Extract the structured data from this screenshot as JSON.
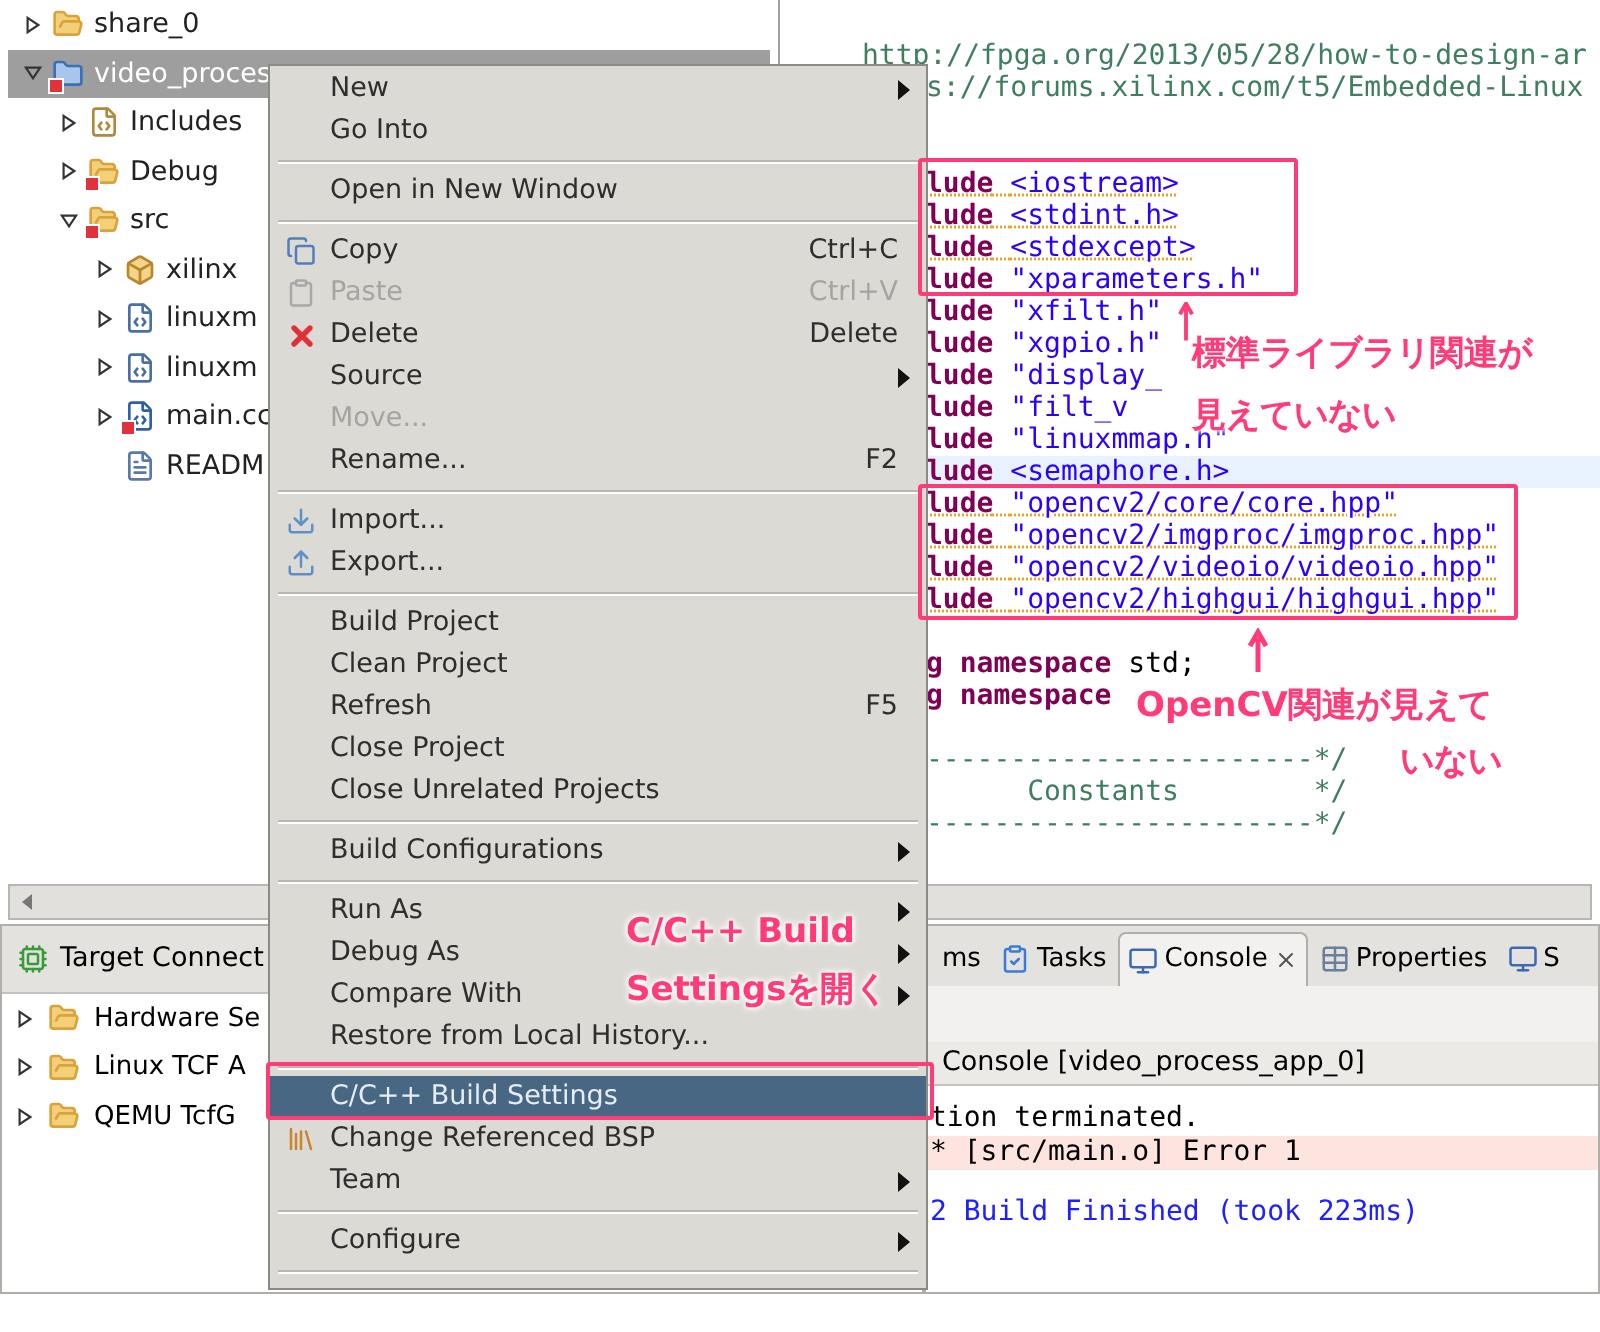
{
  "project_explorer": {
    "items": [
      {
        "label": "share_0",
        "kind": "folder",
        "expanded": false,
        "selected": false,
        "error": false
      },
      {
        "label": "video_proces",
        "kind": "project",
        "expanded": true,
        "selected": true,
        "error": true,
        "children": [
          {
            "label": "Includes",
            "kind": "includes",
            "expanded": false,
            "selected": false,
            "error": false
          },
          {
            "label": "Debug",
            "kind": "folder",
            "expanded": false,
            "selected": false,
            "error": true
          },
          {
            "label": "src",
            "kind": "folder",
            "expanded": true,
            "selected": false,
            "error": true,
            "children": [
              {
                "label": "xilinx",
                "kind": "package",
                "expanded": false,
                "selected": false,
                "error": false
              },
              {
                "label": "linuxm",
                "kind": "source",
                "expanded": false,
                "selected": false,
                "error": false
              },
              {
                "label": "linuxm",
                "kind": "header",
                "expanded": false,
                "selected": false,
                "error": false
              },
              {
                "label": "main.cc",
                "kind": "cfile",
                "expanded": false,
                "selected": false,
                "error": true
              },
              {
                "label": "READM",
                "kind": "text",
                "selected": false,
                "error": false
              }
            ]
          }
        ]
      }
    ]
  },
  "editor": {
    "top_line": "http://fpga.org/2013/05/28/how-to-design-ar",
    "lines": [
      {
        "text": "s://forums.xilinx.com/t5/Embedded-Linux",
        "kind": "comment",
        "warning": false,
        "current": false
      },
      {
        "kind": "blank",
        "current": false
      },
      {
        "kind": "blank",
        "current": false
      },
      {
        "keyword": "lude",
        "text": "<iostream>",
        "kind": "string",
        "warning": true,
        "current": false
      },
      {
        "keyword": "lude",
        "text": "<stdint.h>",
        "kind": "string",
        "warning": true,
        "current": false
      },
      {
        "keyword": "lude",
        "text": "<stdexcept>",
        "kind": "string",
        "warning": true,
        "current": false
      },
      {
        "keyword": "lude",
        "text": "\"xparameters.h\"",
        "kind": "string",
        "warning": false,
        "current": false
      },
      {
        "keyword": "lude",
        "text": "\"xfilt.h\"",
        "kind": "string",
        "warning": false,
        "current": false
      },
      {
        "keyword": "lude",
        "text": "\"xgpio.h\"",
        "kind": "string",
        "warning": false,
        "current": false
      },
      {
        "keyword": "lude",
        "text": "\"display_",
        "kind": "string",
        "warning": false,
        "current": false
      },
      {
        "keyword": "lude",
        "text": "\"filt_v",
        "kind": "string",
        "warning": false,
        "current": false
      },
      {
        "keyword": "lude",
        "text": "\"linuxmmap.h\"",
        "kind": "string",
        "warning": false,
        "current": false
      },
      {
        "keyword": "lude",
        "text": "<semaphore.h>",
        "kind": "string",
        "warning": false,
        "current": true
      },
      {
        "keyword": "lude",
        "text": "\"opencv2/core/core.hpp\"",
        "kind": "string",
        "warning": true,
        "current": false
      },
      {
        "keyword": "lude",
        "text": "\"opencv2/imgproc/imgproc.hpp\"",
        "kind": "string",
        "warning": true,
        "current": false
      },
      {
        "keyword": "lude",
        "text": "\"opencv2/videoio/videoio.hpp\"",
        "kind": "string",
        "warning": true,
        "current": false
      },
      {
        "keyword": "lude",
        "text": "\"opencv2/highgui/highgui.hpp\"",
        "kind": "string",
        "warning": true,
        "current": false
      },
      {
        "kind": "blank",
        "current": false
      },
      {
        "keyword": "g namespace",
        "text": "std;",
        "kind": "plain",
        "warning": false,
        "current": false
      },
      {
        "keyword": "g namespace",
        "kind": "plain",
        "warning": false,
        "current": false
      },
      {
        "kind": "blank",
        "current": false
      },
      {
        "text": "-----------------------*/",
        "kind": "comment",
        "warning": false,
        "current": false
      },
      {
        "text": "      Constants        */",
        "kind": "comment",
        "warning": false,
        "current": false
      },
      {
        "text": "-----------------------*/",
        "kind": "comment",
        "warning": false,
        "current": false
      }
    ]
  },
  "target_connections": {
    "title": "Target Connect",
    "items": [
      {
        "label": "Hardware Se",
        "expanded": false
      },
      {
        "label": "Linux TCF A",
        "expanded": false
      },
      {
        "label": "QEMU TcfG",
        "expanded": false
      }
    ]
  },
  "console": {
    "tabs": [
      {
        "label": "ms",
        "selected": false,
        "closable": false
      },
      {
        "label": "Tasks",
        "selected": false,
        "closable": false
      },
      {
        "label": "Console",
        "selected": true,
        "closable": true
      },
      {
        "label": "Properties",
        "selected": false,
        "closable": false
      },
      {
        "label": "S",
        "selected": false,
        "closable": false
      }
    ],
    "header": "Console [video_process_app_0]",
    "lines": [
      {
        "text": "tion terminated.",
        "kind": "plain"
      },
      {
        "text": "* [src/main.o] Error 1",
        "kind": "error"
      },
      {
        "text": "2 Build Finished (took 223ms)",
        "kind": "info"
      }
    ]
  },
  "context_menu": {
    "items": [
      {
        "kind": "item",
        "label": "New",
        "submenu": true,
        "disabled": false,
        "selected": false
      },
      {
        "kind": "item",
        "label": "Go Into",
        "submenu": false,
        "disabled": false,
        "selected": false
      },
      {
        "kind": "separator"
      },
      {
        "kind": "item",
        "label": "Open in New Window",
        "submenu": false,
        "disabled": false,
        "selected": false
      },
      {
        "kind": "separator"
      },
      {
        "kind": "item",
        "label": "Copy",
        "shortcut": "Ctrl+C",
        "submenu": false,
        "disabled": false,
        "selected": false
      },
      {
        "kind": "item",
        "label": "Paste",
        "shortcut": "Ctrl+V",
        "submenu": false,
        "disabled": true,
        "selected": false
      },
      {
        "kind": "item",
        "label": "Delete",
        "shortcut": "Delete",
        "submenu": false,
        "disabled": false,
        "selected": false
      },
      {
        "kind": "item",
        "label": "Source",
        "submenu": true,
        "disabled": false,
        "selected": false
      },
      {
        "kind": "item",
        "label": "Move...",
        "submenu": false,
        "disabled": true,
        "selected": false
      },
      {
        "kind": "item",
        "label": "Rename...",
        "shortcut": "F2",
        "submenu": false,
        "disabled": false,
        "selected": false
      },
      {
        "kind": "separator"
      },
      {
        "kind": "item",
        "label": "Import...",
        "submenu": false,
        "disabled": false,
        "selected": false
      },
      {
        "kind": "item",
        "label": "Export...",
        "submenu": false,
        "disabled": false,
        "selected": false
      },
      {
        "kind": "separator"
      },
      {
        "kind": "item",
        "label": "Build Project",
        "submenu": false,
        "disabled": false,
        "selected": false
      },
      {
        "kind": "item",
        "label": "Clean Project",
        "submenu": false,
        "disabled": false,
        "selected": false
      },
      {
        "kind": "item",
        "label": "Refresh",
        "shortcut": "F5",
        "submenu": false,
        "disabled": false,
        "selected": false
      },
      {
        "kind": "item",
        "label": "Close Project",
        "submenu": false,
        "disabled": false,
        "selected": false
      },
      {
        "kind": "item",
        "label": "Close Unrelated Projects",
        "submenu": false,
        "disabled": false,
        "selected": false
      },
      {
        "kind": "separator"
      },
      {
        "kind": "item",
        "label": "Build Configurations",
        "submenu": true,
        "disabled": false,
        "selected": false
      },
      {
        "kind": "separator"
      },
      {
        "kind": "item",
        "label": "Run As",
        "submenu": true,
        "disabled": false,
        "selected": false
      },
      {
        "kind": "item",
        "label": "Debug As",
        "submenu": true,
        "disabled": false,
        "selected": false
      },
      {
        "kind": "item",
        "label": "Compare With",
        "submenu": true,
        "disabled": false,
        "selected": false
      },
      {
        "kind": "item",
        "label": "Restore from Local History...",
        "submenu": false,
        "disabled": false,
        "selected": false
      },
      {
        "kind": "separator"
      },
      {
        "kind": "item",
        "label": "C/C++ Build Settings",
        "submenu": false,
        "disabled": false,
        "selected": true
      },
      {
        "kind": "item",
        "label": "Change Referenced BSP",
        "submenu": false,
        "disabled": false,
        "selected": false
      },
      {
        "kind": "item",
        "label": "Team",
        "submenu": true,
        "disabled": false,
        "selected": false
      },
      {
        "kind": "separator"
      },
      {
        "kind": "item",
        "label": "Configure",
        "submenu": true,
        "disabled": false,
        "selected": false
      },
      {
        "kind": "separator"
      }
    ]
  },
  "annotations": [
    {
      "lines": [
        "標準ライブラリ関連が",
        "見えていない"
      ]
    },
    {
      "lines": [
        "OpenCV関連が見えて",
        "いない"
      ]
    },
    {
      "lines": [
        "C/C++ Build",
        "Settingsを開く"
      ]
    }
  ]
}
